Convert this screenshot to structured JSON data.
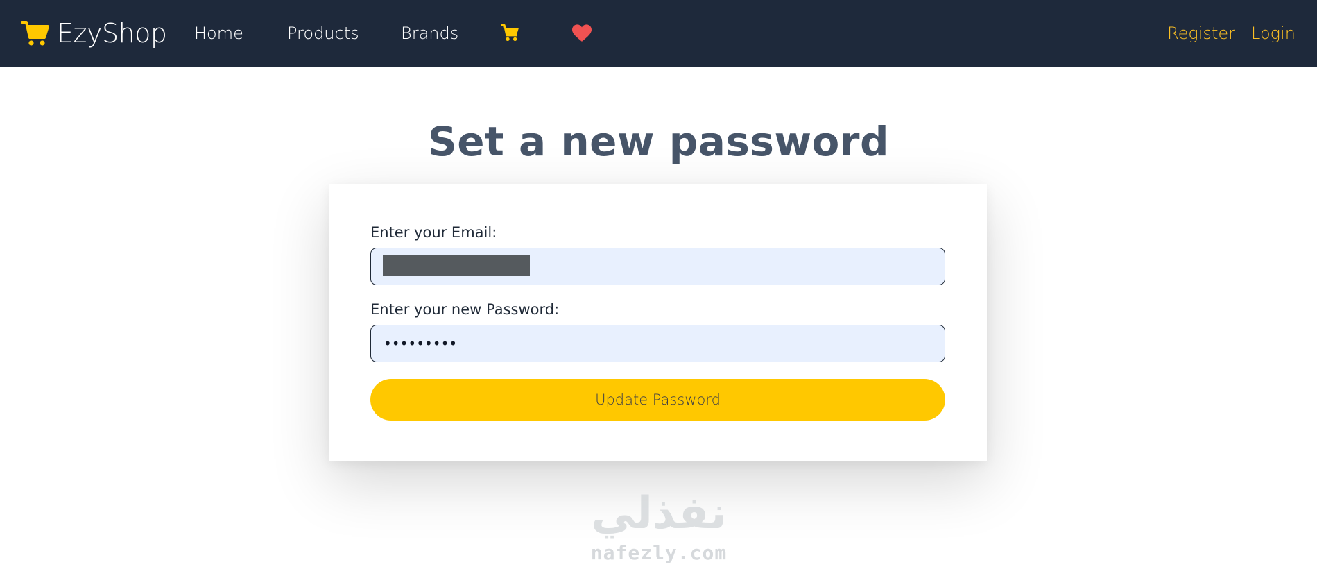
{
  "colors": {
    "navbar_bg": "#1e293b",
    "accent": "#ffc800",
    "auth_link": "#fbbf24",
    "heart": "#f05252",
    "title": "#475569",
    "input_bg": "#e8f0fe"
  },
  "navbar": {
    "brand_icon": "shopping-cart-icon",
    "brand_name": "EzyShop",
    "links": [
      {
        "label": "Home"
      },
      {
        "label": "Products"
      },
      {
        "label": "Brands"
      }
    ],
    "icons": [
      "shopping-cart-icon",
      "heart-icon"
    ],
    "register_label": "Register",
    "login_label": "Login"
  },
  "page": {
    "title": "Set a new password"
  },
  "form": {
    "email_label": "Enter your Email:",
    "email_value": "",
    "password_label": "Enter your new Password:",
    "password_value": "•••••••••",
    "submit_label": "Update Password"
  },
  "watermark": {
    "arabic": "نفذلي",
    "latin": "nafezly.com"
  }
}
